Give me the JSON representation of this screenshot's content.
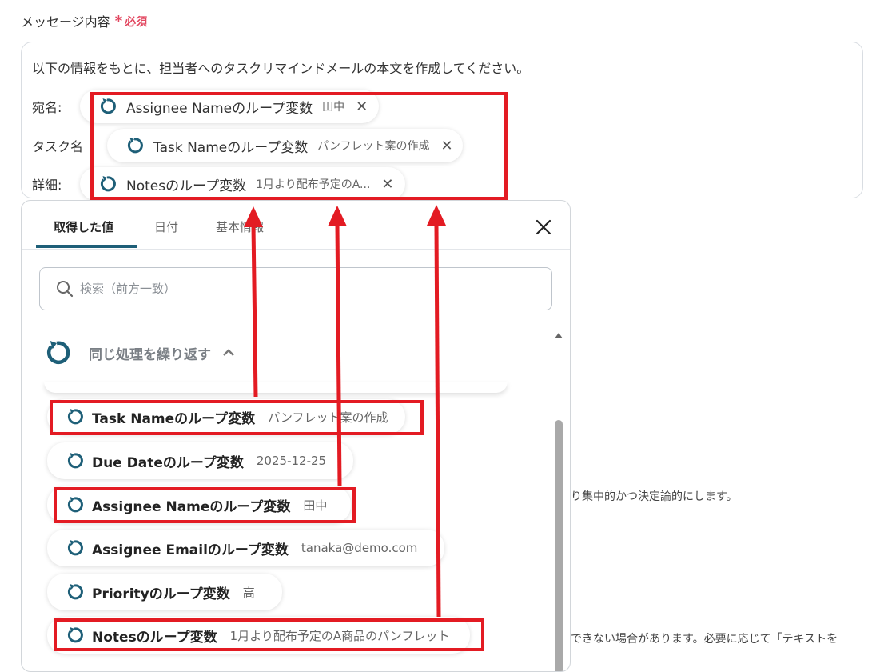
{
  "field": {
    "label": "メッセージ内容",
    "required": "必須"
  },
  "message": {
    "intro": "以下の情報をもとに、担当者へのタスクリマインドメールの本文を作成してください。",
    "lines": [
      {
        "label": "宛名:",
        "variable": "Assignee Nameのループ変数",
        "value": "田中"
      },
      {
        "label": "タスク名",
        "variable": "Task Nameのループ変数",
        "value": "パンフレット案の作成"
      },
      {
        "label": "詳細:",
        "variable": "Notesのループ変数",
        "value": "1月より配布予定のA..."
      }
    ]
  },
  "panel": {
    "tabs": [
      "取得した値",
      "日付",
      "基本情報"
    ],
    "search_placeholder": "検索（前方一致）",
    "group_title": "同じ処理を繰り返す",
    "items": [
      {
        "name": "Task Nameのループ変数",
        "value": "パンフレット案の作成"
      },
      {
        "name": "Due Dateのループ変数",
        "value": "2025-12-25"
      },
      {
        "name": "Assignee Nameのループ変数",
        "value": "田中"
      },
      {
        "name": "Assignee Emailのループ変数",
        "value": "tanaka@demo.com"
      },
      {
        "name": "Priorityのループ変数",
        "value": "高"
      },
      {
        "name": "Notesのループ変数",
        "value": "1月より配布予定のA商品のパンフレット"
      }
    ]
  },
  "background_text": {
    "line1": "り集中的かつ決定論的にします。",
    "line2": "できない場合があります。必要に応じて「テキストを"
  },
  "colors": {
    "accent": "#1e5f78",
    "highlight": "#e31b23",
    "required": "#e2465f"
  }
}
